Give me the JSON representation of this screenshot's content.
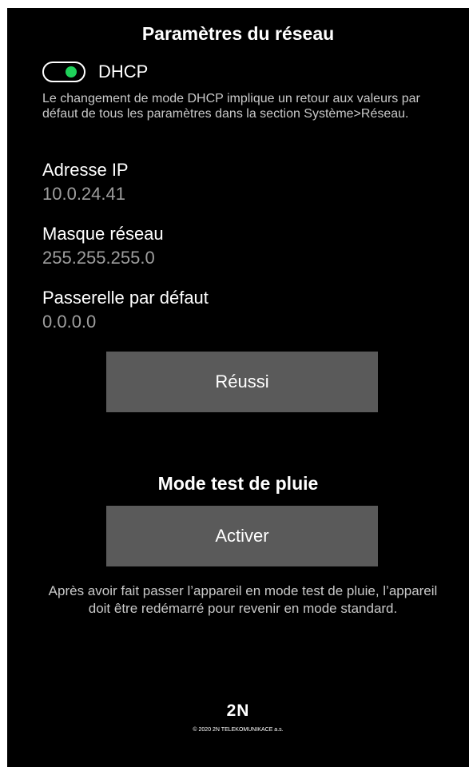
{
  "header": {
    "title": "Paramètres du réseau"
  },
  "dhcp": {
    "label": "DHCP",
    "enabled": true,
    "note": "Le changement de mode DHCP implique un retour aux valeurs par défaut de tous les paramètres dans la section Système>Réseau."
  },
  "fields": {
    "ip_label": "Adresse IP",
    "ip_value": "10.0.24.41",
    "mask_label": "Masque réseau",
    "mask_value": "255.255.255.0",
    "gateway_label": "Passerelle par défaut",
    "gateway_value": "0.0.0.0"
  },
  "buttons": {
    "success_label": "Réussi",
    "activate_label": "Activer"
  },
  "rain_test": {
    "title": "Mode test de pluie",
    "note": "Après avoir fait passer l’appareil en mode test de pluie, l’appareil doit être redémarré pour revenir en mode standard."
  },
  "footer": {
    "logo": "2N",
    "copyright": "© 2020 2N TELEKOMUNIKACE a.s."
  },
  "colors": {
    "background": "#000000",
    "button": "#5a5a5a",
    "toggle_on": "#1fd15a",
    "value_text": "#9e9e9e"
  },
  "icons": {
    "toggle": "toggle-on-icon"
  }
}
